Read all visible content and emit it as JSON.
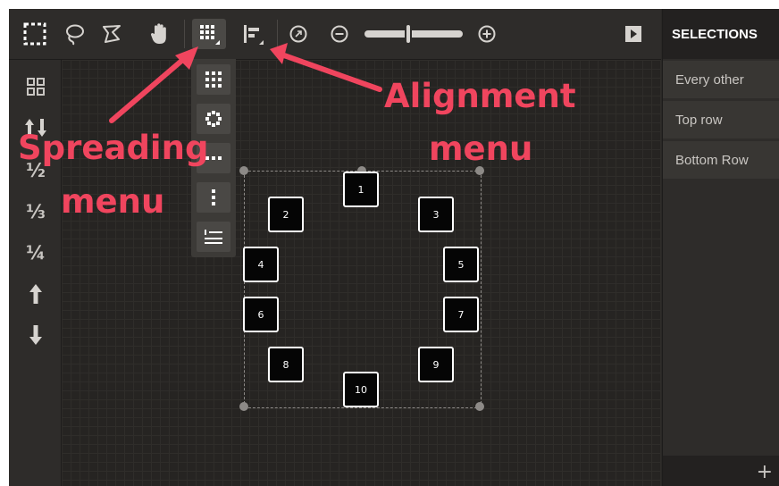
{
  "selections": {
    "title": "SELECTIONS",
    "items": [
      {
        "label": "Every other"
      },
      {
        "label": "Top row"
      },
      {
        "label": "Bottom Row"
      }
    ],
    "add_label": "+"
  },
  "left_rail": {
    "half": "½",
    "third": "⅓",
    "quarter": "¼"
  },
  "nodes": [
    "1",
    "2",
    "3",
    "4",
    "5",
    "6",
    "7",
    "8",
    "9",
    "10"
  ],
  "annotations": {
    "spreading_line1": "Spreading",
    "spreading_line2": "menu",
    "alignment_line1": "Alignment",
    "alignment_line2": "menu"
  },
  "colors": {
    "annotation": "#f0455e",
    "background": "#2a2826",
    "panel": "#2e2c2a"
  }
}
